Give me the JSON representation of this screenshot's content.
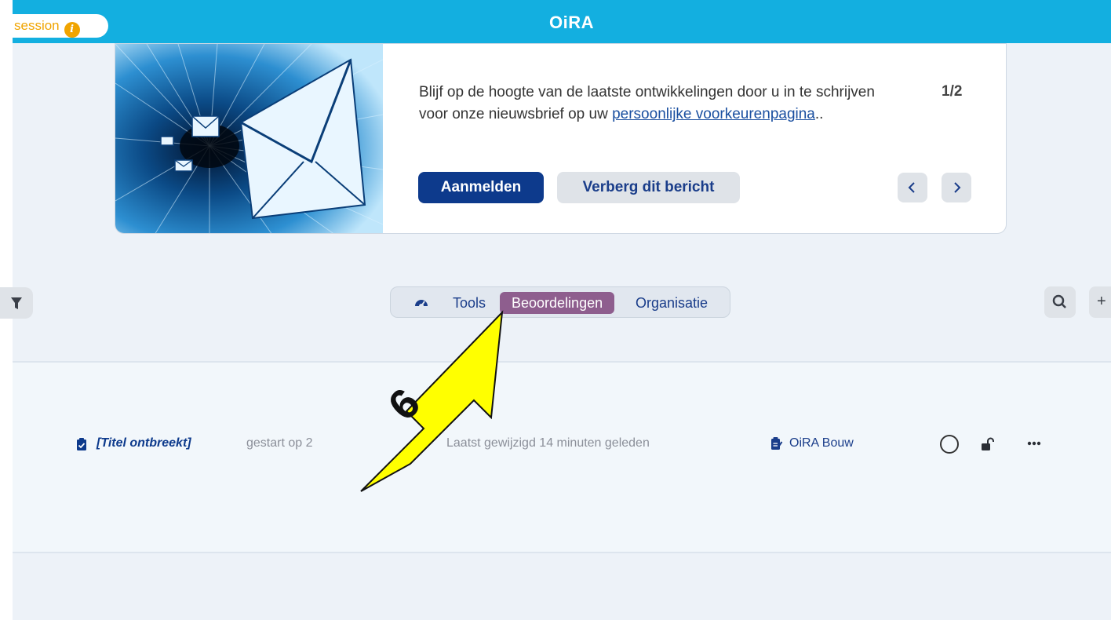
{
  "header": {
    "brand": "OiRA",
    "session_label": "session",
    "session_info_glyph": "i"
  },
  "banner": {
    "message_start": "Blijf op de hoogte van de laatste ontwikkelingen door u in te schrijven voor onze nieuwsbrief op uw ",
    "link_text": "persoonlijke voorkeurenpagina",
    "message_end": "..",
    "pager": "1/2",
    "subscribe_label": "Aanmelden",
    "hide_label": "Verberg dit bericht",
    "prev_icon": "chevron-left",
    "next_icon": "chevron-right"
  },
  "toolbar": {
    "filter_icon": "filter-icon",
    "tabs": [
      {
        "label": "Tools",
        "active": false
      },
      {
        "label": "Beoordelingen",
        "active": true
      },
      {
        "label": "Organisatie",
        "active": false
      }
    ],
    "search_icon": "search-icon",
    "add_icon": "plus-icon",
    "add_glyph": "+"
  },
  "assessment_row": {
    "title": "[Titel ontbreekt]",
    "started": "gestart op 2",
    "modified": "Laatst gewijzigd 14 minuten geleden",
    "organisation": "OiRA Bouw"
  },
  "annotation": {
    "step_number": "6"
  },
  "colors": {
    "topbar": "#13afe0",
    "session_accent": "#f0a400",
    "primary": "#0d3a8c",
    "active_tab": "#8e5e8e",
    "arrow_fill": "#ffff00"
  }
}
